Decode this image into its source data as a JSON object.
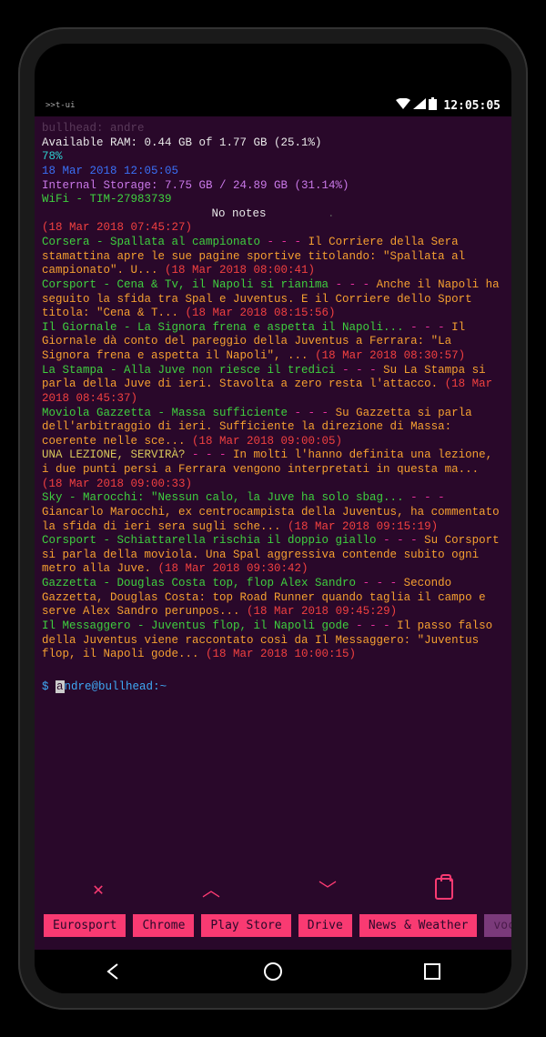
{
  "status": {
    "left": ">>t-ui",
    "time": "12:05:05"
  },
  "header_dim": "bullhead: andre",
  "ram": {
    "label": "Available RAM: 0.44 GB of 1.77 GB (25.1%)",
    "pct": "78%"
  },
  "datetime": "18 Mar 2018 12:05:05",
  "storage": "Internal Storage: 7.75 GB / 24.89 GB (31.14%)",
  "wifi": "WiFi - TIM-27983739",
  "notes": "No notes",
  "dot": ".",
  "ts0": "(18 Mar 2018 07:45:27)",
  "feeds": [
    {
      "title": "Corsera - Spallata al campionato",
      "sep": " - - - ",
      "body": "Il Corriere della Sera stamattina apre le sue pagine sportive titolando: \"Spallata al campionato\". U... ",
      "ts": "(18 Mar 2018 08:00:41)"
    },
    {
      "title": "Corsport - Cena & Tv, il Napoli si rianima",
      "sep": " - - - ",
      "body": "Anche il Napoli ha seguito la sfida tra Spal e Juventus. E il Corriere dello Sport titola: \"Cena & T... ",
      "ts": "(18 Mar 2018 08:15:56)"
    },
    {
      "title": "Il Giornale - La Signora frena e aspetta il Napoli...",
      "sep": " - - - ",
      "body": "Il Giornale dà conto del pareggio della Juventus a Ferrara: \"La Signora frena e aspetta il Napoli\", ... ",
      "ts": "(18 Mar 2018 08:30:57)"
    },
    {
      "title": "La Stampa - Alla Juve non riesce il tredici",
      "sep": " - - - ",
      "body": "Su La Stampa si parla della Juve di ieri. Stavolta a zero resta l'attacco. ",
      "ts": "(18 Mar 2018 08:45:37)"
    },
    {
      "title": "Moviola Gazzetta - Massa sufficiente",
      "sep": " - - - ",
      "body": "Su Gazzetta si parla dell'arbitraggio di ieri. Sufficiente la direzione di Massa: coerente nelle sce... ",
      "ts": "(18 Mar 2018 09:00:05)"
    },
    {
      "title": "UNA LEZIONE, SERVIRÀ?",
      "sep": " - - - ",
      "body": "In molti l'hanno definita una lezione, i due punti persi a Ferrara vengono interpretati in questa ma... ",
      "ts": "(18 Mar 2018 09:00:33)"
    },
    {
      "title": "Sky - Marocchi: \"Nessun calo, la Juve ha solo sbag...",
      "sep": " - - - ",
      "body": "Giancarlo Marocchi, ex centrocampista della Juventus, ha commentato la sfida di ieri sera sugli sche... ",
      "ts": "(18 Mar 2018 09:15:19)"
    },
    {
      "title": "Corsport - Schiattarella rischia il doppio giallo",
      "sep": " - - - ",
      "body": "Su Corsport si parla della moviola. Una Spal aggressiva contende subito ogni metro alla Juve. ",
      "ts": "(18 Mar 2018 09:30:42)"
    },
    {
      "title": "Gazzetta - Douglas Costa top, flop Alex Sandro",
      "sep": " - - - ",
      "body": "Secondo Gazzetta, Douglas Costa: top Road Runner quando taglia il campo e serve Alex Sandro perunpos... ",
      "ts": "(18 Mar 2018 09:45:29)"
    },
    {
      "title": "Il Messaggero - Juventus flop, il Napoli gode",
      "sep": " - - - ",
      "body": "Il passo falso della Juventus viene raccontato così da Il Messaggero: \"Juventus flop, il Napoli gode... ",
      "ts": "(18 Mar 2018 10:00:15)"
    }
  ],
  "prompt": {
    "symbol": "$",
    "cursor_char": "a",
    "rest": "ndre@bullhead:~"
  },
  "apps": [
    "Eurosport",
    "Chrome",
    "Play Store",
    "Drive",
    "News & Weather",
    "voc"
  ]
}
